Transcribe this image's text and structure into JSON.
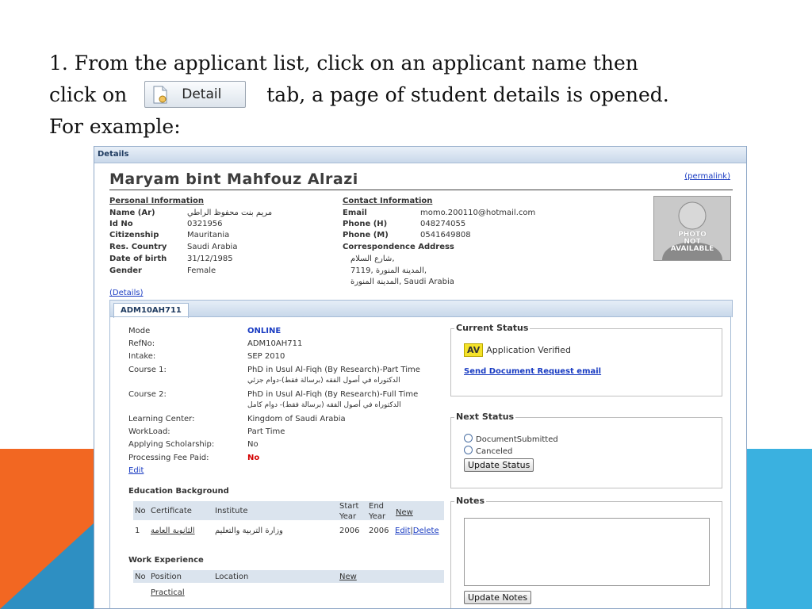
{
  "slide": {
    "line1": "1. From the applicant list, click on an applicant name then",
    "line2_pre": "click on",
    "detail_button_label": "Detail",
    "line2_post": "tab, a page of student details is opened.",
    "line3": "For example:"
  },
  "panel_title": "Details",
  "applicant": {
    "name": "Maryam bint Mahfouz Alrazi",
    "permalink": "(permalink)"
  },
  "personal": {
    "header": "Personal Information",
    "rows": [
      {
        "label": "Name (Ar)",
        "value": "مريم بنت محفوظ الراطي"
      },
      {
        "label": "Id No",
        "value": "0321956"
      },
      {
        "label": "Citizenship",
        "value": "Mauritania"
      },
      {
        "label": "Res. Country",
        "value": "Saudi Arabia"
      },
      {
        "label": "Date of birth",
        "value": "31/12/1985"
      },
      {
        "label": "Gender",
        "value": "Female"
      }
    ],
    "details_link": "(Details)"
  },
  "contact": {
    "header": "Contact Information",
    "rows": [
      {
        "label": "Email",
        "value": "momo.200110@hotmail.com"
      },
      {
        "label": "Phone (H)",
        "value": "048274055"
      },
      {
        "label": "Phone (M)",
        "value": "0541649808"
      }
    ],
    "address_label": "Correspondence Address",
    "address_lines": [
      "شارع السلام,",
      "7119, المدينة المنورة,",
      "المدينة المنورة, Saudi Arabia"
    ]
  },
  "photo": {
    "line1": "PHOTO",
    "line2": "NOT",
    "line3": "AVAILABLE"
  },
  "tab_label": "ADM10AH711",
  "application": {
    "rows": [
      {
        "label": "Mode",
        "value": "ONLINE",
        "value2": ""
      },
      {
        "label": "RefNo:",
        "value": "ADM10AH711",
        "value2": ""
      },
      {
        "label": "Intake:",
        "value": "SEP 2010",
        "value2": ""
      },
      {
        "label": "Course 1:",
        "value": "PhD in Usul Al-Fiqh (By Research)-Part Time",
        "value2": "الدكتوراه في أصول الفقه (برسالة فقط)-دوام جزئي"
      },
      {
        "label": "Course 2:",
        "value": "PhD in Usul Al-Fiqh (By Research)-Full Time",
        "value2": "الدكتوراه في أصول الفقه (برسالة فقط)- دوام كامل"
      },
      {
        "label": "Learning Center:",
        "value": "Kingdom of Saudi Arabia",
        "value2": ""
      },
      {
        "label": "WorkLoad:",
        "value": "Part Time",
        "value2": ""
      },
      {
        "label": "Applying Scholarship:",
        "value": "No",
        "value2": ""
      },
      {
        "label": "Processing Fee Paid:",
        "value": "No",
        "value2": ""
      }
    ],
    "edit_link": "Edit"
  },
  "current_status": {
    "legend": "Current Status",
    "badge": "AV",
    "status": "Application Verified",
    "email_link": "Send Document Request email"
  },
  "next_status": {
    "legend": "Next Status",
    "options": [
      "DocumentSubmitted",
      "Canceled"
    ],
    "update_button": "Update Status"
  },
  "notes": {
    "legend": "Notes",
    "update_button": "Update Notes"
  },
  "education": {
    "title": "Education Background",
    "headers": {
      "no": "No",
      "certificate": "Certificate",
      "institute": "Institute",
      "start1": "Start",
      "start2": "Year",
      "end1": "End",
      "end2": "Year",
      "new": "New"
    },
    "row": {
      "no": "1",
      "certificate": "الثانوية العامة",
      "institute": "وزارة التربية والتعليم",
      "start": "2006",
      "end": "2006",
      "edit": "Edit",
      "sep": "|",
      "delete": "Delete"
    }
  },
  "work": {
    "title": "Work Experience",
    "headers": {
      "no": "No",
      "position": "Position",
      "location": "Location",
      "new": "New"
    },
    "partial_row": "Practical"
  },
  "colors": {
    "orange": "#f26722",
    "blue": "#3ab1e0",
    "link": "#1a3cc2",
    "online": "#1a3cc2",
    "no_red": "#d40000"
  }
}
